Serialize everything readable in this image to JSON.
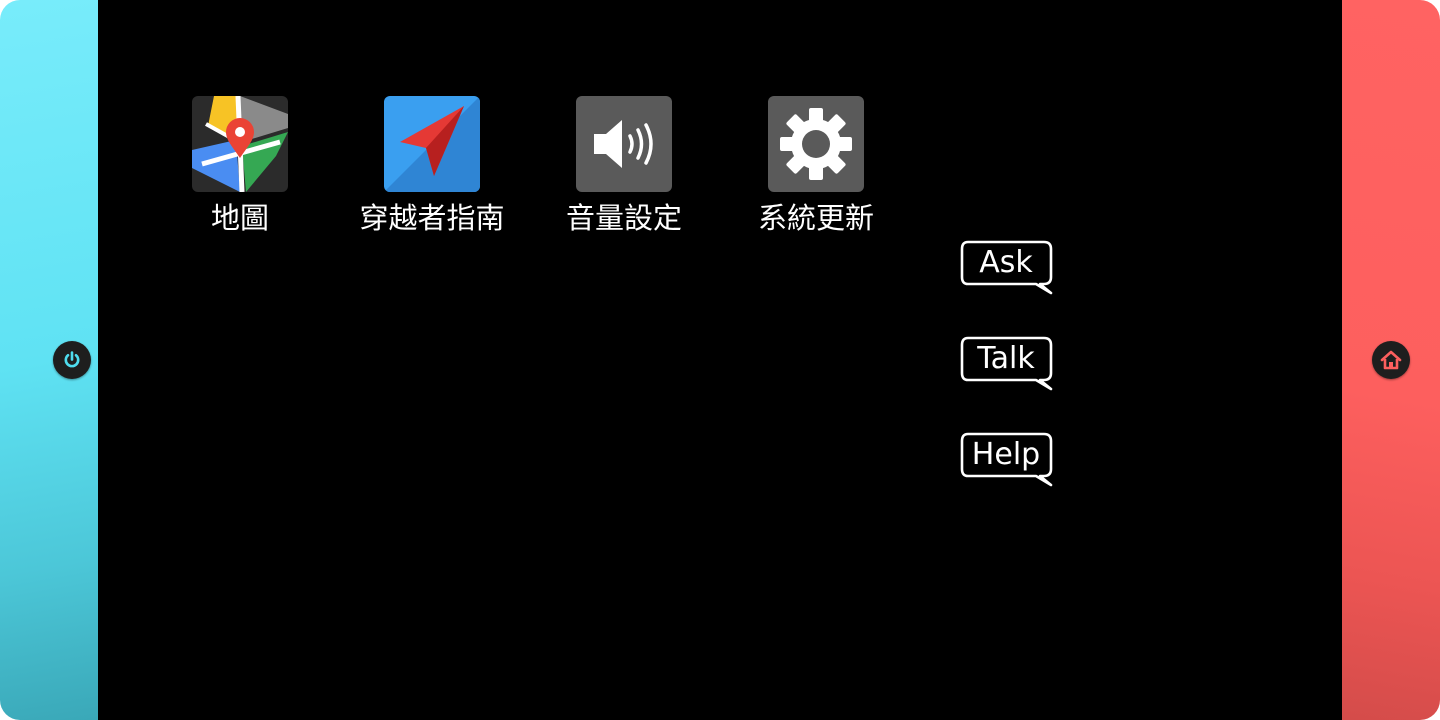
{
  "apps": [
    {
      "label": "地圖",
      "icon": "map-pin-icon"
    },
    {
      "label": "穿越者指南",
      "icon": "navigation-arrow-icon"
    },
    {
      "label": "音量設定",
      "icon": "speaker-volume-icon"
    },
    {
      "label": "系統更新",
      "icon": "gear-icon"
    }
  ],
  "bubbles": [
    {
      "label": "Ask"
    },
    {
      "label": "Talk"
    },
    {
      "label": "Help"
    }
  ],
  "controls": {
    "left_button_icon": "power-icon",
    "right_button_icon": "home-icon"
  },
  "colors": {
    "left_joycon": "#5fe2f3",
    "right_joycon": "#fd5f5e",
    "screen": "#000000",
    "map_pin": "#ea4335",
    "nav_icon_bg": "#2f8ce0",
    "nav_arrow": "#e53935",
    "volume_icon_bg": "#5a5a5a",
    "gear_icon_bg": "#5a5a5a"
  }
}
